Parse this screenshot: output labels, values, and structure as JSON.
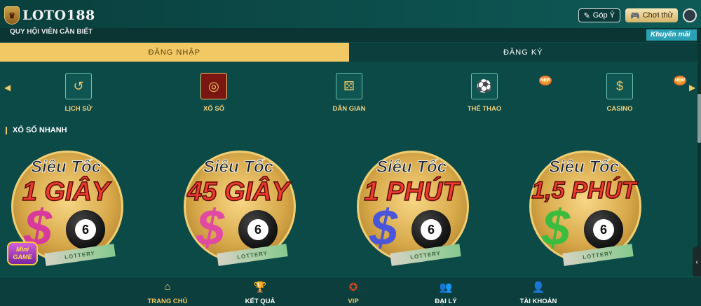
{
  "header": {
    "brand": "LOTO188",
    "feedback_label": "Góp Ý",
    "trial_label": "Chơi thử"
  },
  "notice": {
    "text": "QUY HỘI VIÊN CẦN BIẾT",
    "tag": "Khuyến mãi"
  },
  "auth": {
    "login": "ĐĂNG NHẬP",
    "register": "ĐĂNG KÝ"
  },
  "categories": [
    {
      "label": "LỊCH SỬ",
      "icon": "history-icon",
      "glyph": "↺"
    },
    {
      "label": "XỔ SỐ",
      "icon": "lottery-icon",
      "glyph": "◎"
    },
    {
      "label": "DÂN GIAN",
      "icon": "dice-icon",
      "glyph": "⚄"
    },
    {
      "label": "THỂ THAO",
      "icon": "sports-icon",
      "glyph": "⚽"
    },
    {
      "label": "CASINO",
      "icon": "casino-chip-icon",
      "glyph": "$"
    }
  ],
  "hot_badge": "NEW",
  "section": {
    "title": "XỔ SỐ NHANH"
  },
  "games": [
    {
      "line1": "Siêu Tốc",
      "line2": "1 GIÂY",
      "ball": "6",
      "dollar_color": "#d7399c",
      "ticket": "LOTTERY"
    },
    {
      "line1": "Siêu Tốc",
      "line2": "45 GIÂY",
      "ball": "6",
      "dollar_color": "#e04aa3",
      "ticket": "LOTTERY"
    },
    {
      "line1": "Siêu Tốc",
      "line2": "1 PHÚT",
      "ball": "6",
      "dollar_color": "#4b55d9",
      "ticket": "LOTTERY"
    },
    {
      "line1": "Siêu Tốc",
      "line2": "1,5 PHÚT",
      "ball": "6",
      "dollar_color": "#3cbc3f",
      "ticket": "LOTTERY"
    }
  ],
  "minigame": {
    "line1": "Mini",
    "line2": "GAME"
  },
  "bottom_nav": [
    {
      "label": "TRANG CHỦ",
      "icon": "home-icon",
      "glyph": "⌂"
    },
    {
      "label": "KẾT QUẢ",
      "icon": "trophy-icon",
      "glyph": "🏆"
    },
    {
      "label": "VIP",
      "icon": "vip-icon",
      "glyph": "✪"
    },
    {
      "label": "ĐẠI LÝ",
      "icon": "agents-icon",
      "glyph": "👥"
    },
    {
      "label": "TÀI KHOẢN",
      "icon": "account-icon",
      "glyph": "👤"
    }
  ]
}
